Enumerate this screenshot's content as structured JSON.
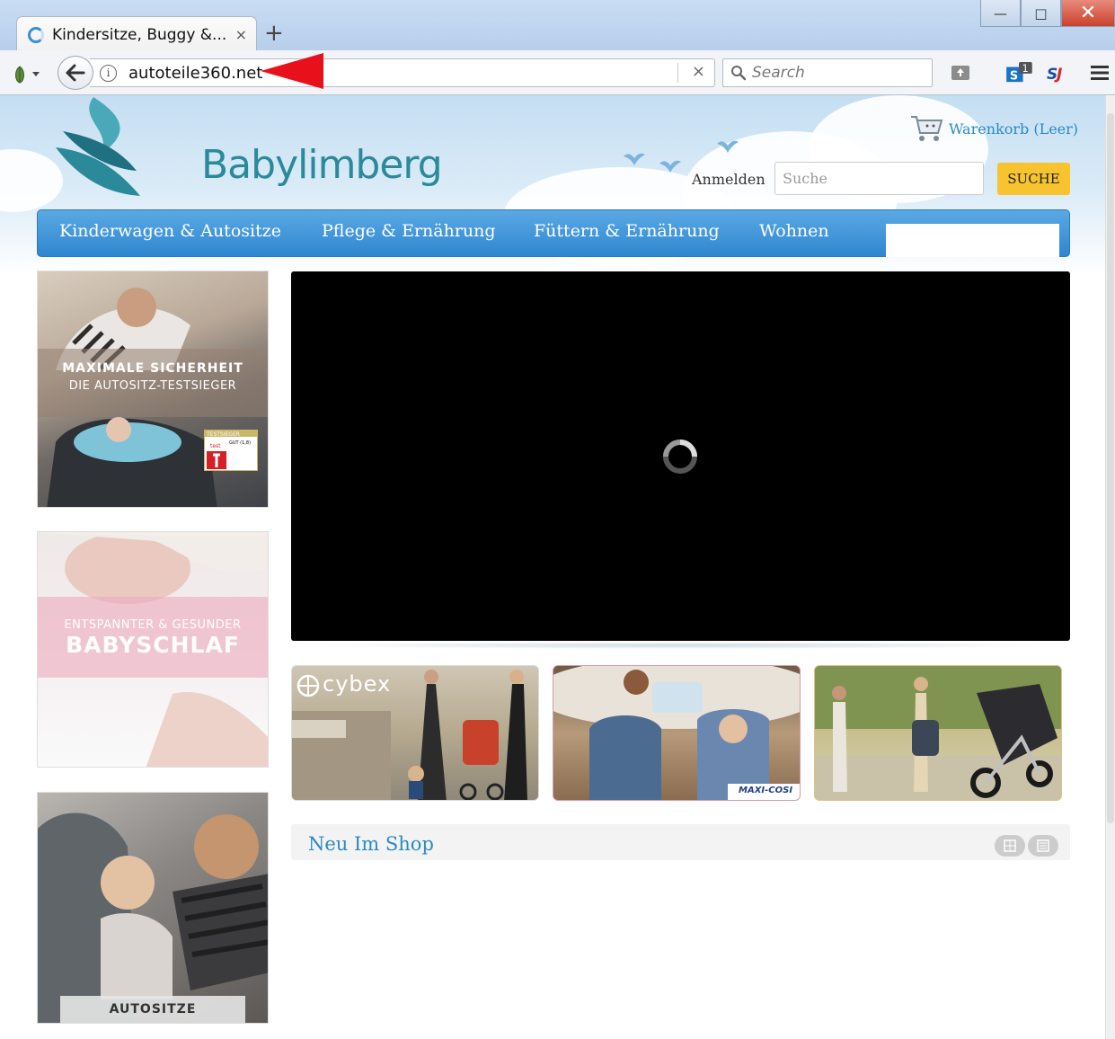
{
  "browser": {
    "tab_title": "Kindersitze, Buggy &...",
    "tab_close": "×",
    "new_tab": "+",
    "window_minimize": "—",
    "window_maximize": "□",
    "window_close": "✕",
    "url": "autoteile360.net",
    "url_clear": "×",
    "search_placeholder": "Search",
    "extension_badge": "1"
  },
  "header": {
    "logo_text": "Babylimberg",
    "cart_label": "Warenkorb (Leer)",
    "login_label": "Anmelden",
    "search_placeholder": "Suche",
    "search_button": "SUCHE"
  },
  "nav": {
    "items": [
      {
        "label": "Kinderwagen & Autositze"
      },
      {
        "label": "Pflege & Ernährung"
      },
      {
        "label": "Füttern & Ernährung"
      },
      {
        "label": "Wohnen"
      }
    ]
  },
  "banners": [
    {
      "line1": "MAXIMALE SICHERHEIT",
      "line2": "DIE AUTOSITZ-TESTSIEGER",
      "seal_title": "TESTSIEGER",
      "seal_rating": "GUT (1,8)",
      "seal_brand": "test"
    },
    {
      "line1": "ENTSPANNTER & GESUNDER",
      "line2": "BABYSCHLAF"
    },
    {
      "line1": "AUTOSITZE"
    }
  ],
  "promos": [
    {
      "brand": "cybex"
    },
    {
      "brand": "MAXI-COSI"
    },
    {
      "brand": ""
    }
  ],
  "new_in_shop": {
    "title": "Neu Im Shop"
  },
  "colors": {
    "nav_blue": "#3b90d6",
    "link_blue": "#2a8ac5",
    "search_button": "#f7c430",
    "logo_teal": "#2a8a9a",
    "annotation_red": "#e8101a"
  }
}
